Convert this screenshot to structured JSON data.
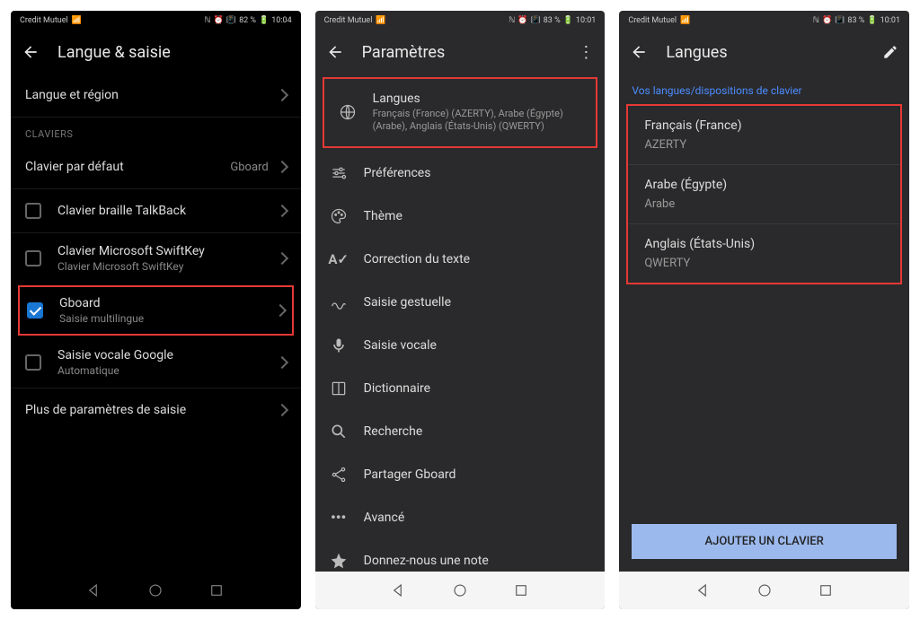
{
  "status": {
    "carrier": "Credit Mutuel",
    "battery1": "82 %",
    "battery2": "83 %",
    "battery3": "83 %",
    "time1": "10:04",
    "time2": "10:01",
    "time3": "10:01"
  },
  "screen1": {
    "title": "Langue & saisie",
    "langRegion": "Langue et région",
    "sectionKeyboards": "CLAVIERS",
    "defaultKeyboard": {
      "label": "Clavier par défaut",
      "value": "Gboard"
    },
    "keyboards": [
      {
        "label": "Clavier braille TalkBack",
        "sub": ""
      },
      {
        "label": "Clavier Microsoft SwiftKey",
        "sub": "Clavier Microsoft SwiftKey"
      },
      {
        "label": "Gboard",
        "sub": "Saisie multilingue"
      },
      {
        "label": "Saisie vocale Google",
        "sub": "Automatique"
      }
    ],
    "moreSettings": "Plus de paramètres de saisie"
  },
  "screen2": {
    "title": "Paramètres",
    "items": [
      {
        "label": "Langues",
        "sub": "Français (France) (AZERTY), Arabe (Égypte) (Arabe), Anglais (États-Unis) (QWERTY)"
      },
      {
        "label": "Préférences"
      },
      {
        "label": "Thème"
      },
      {
        "label": "Correction du texte"
      },
      {
        "label": "Saisie gestuelle"
      },
      {
        "label": "Saisie vocale"
      },
      {
        "label": "Dictionnaire"
      },
      {
        "label": "Recherche"
      },
      {
        "label": "Partager Gboard"
      },
      {
        "label": "Avancé"
      },
      {
        "label": "Donnez-nous une note"
      }
    ]
  },
  "screen3": {
    "title": "Langues",
    "sectionHeader": "Vos langues/dispositions de clavier",
    "langs": [
      {
        "name": "Français (France)",
        "layout": "AZERTY"
      },
      {
        "name": "Arabe (Égypte)",
        "layout": "Arabe"
      },
      {
        "name": "Anglais (États-Unis)",
        "layout": "QWERTY"
      }
    ],
    "addButton": "AJOUTER UN CLAVIER"
  }
}
